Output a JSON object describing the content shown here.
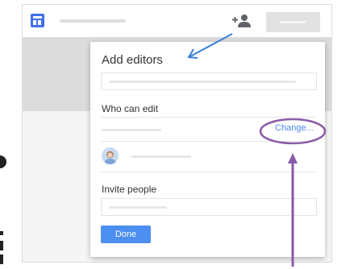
{
  "dialog": {
    "title": "Add editors",
    "who_can_edit_label": "Who can edit",
    "change_link": "Change...",
    "invite_label": "Invite people",
    "done_button": "Done"
  },
  "colors": {
    "accent": "#4a86e8",
    "done_button": "#4d8ff0",
    "app_icon": "#3f70e8",
    "annotation_arrow_blue": "#3a7fd6",
    "annotation_circle_purple": "#8a5aa6"
  },
  "icons": {
    "app": "sheets-app-icon",
    "add_person": "add-person-icon",
    "avatar": "user-avatar"
  }
}
